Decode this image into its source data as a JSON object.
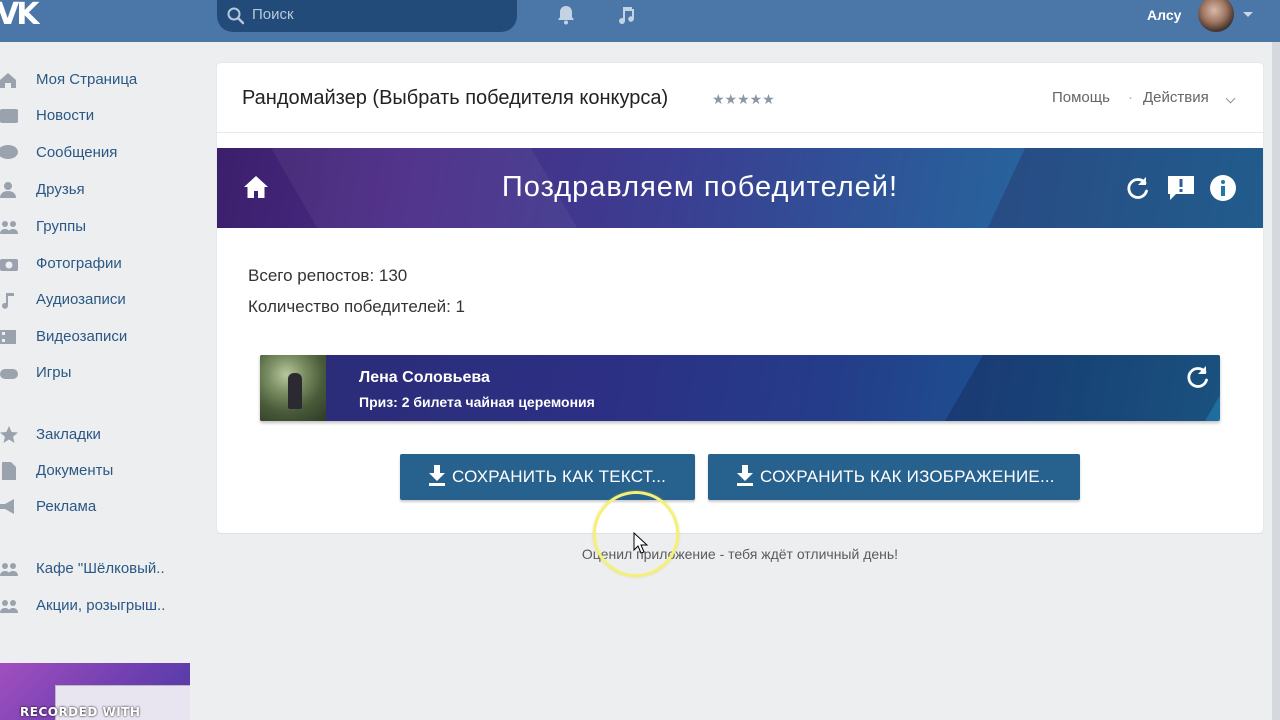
{
  "topbar": {
    "logo": "VK",
    "search_placeholder": "Поиск",
    "username": "Алсу"
  },
  "sidebar": {
    "items": [
      {
        "label": "Моя Страница",
        "icon": "home-icon"
      },
      {
        "label": "Новости",
        "icon": "news-icon"
      },
      {
        "label": "Сообщения",
        "icon": "messages-icon"
      },
      {
        "label": "Друзья",
        "icon": "friends-icon"
      },
      {
        "label": "Группы",
        "icon": "groups-icon"
      },
      {
        "label": "Фотографии",
        "icon": "camera-icon"
      },
      {
        "label": "Аудиозаписи",
        "icon": "music-icon"
      },
      {
        "label": "Видеозаписи",
        "icon": "video-icon"
      },
      {
        "label": "Игры",
        "icon": "gamepad-icon"
      },
      {
        "label": "Закладки",
        "icon": "star-icon"
      },
      {
        "label": "Документы",
        "icon": "document-icon"
      },
      {
        "label": "Реклама",
        "icon": "megaphone-icon"
      },
      {
        "label": "Кафе \"Шёлковый..",
        "icon": "group-icon"
      },
      {
        "label": "Акции, розыгрыш..",
        "icon": "group-icon"
      }
    ],
    "promo_text": "RECORDED WITH"
  },
  "app": {
    "title": "Рандомайзер (Выбрать победителя конкурса)",
    "stars": "★★★★★",
    "help_label": "Помощь",
    "separator": "·",
    "actions_label": "Действия",
    "banner_title": "Поздравляем победителей!",
    "stats": {
      "reposts": "Всего репостов: 130",
      "winners_count": "Количество победителей: 1"
    },
    "winner": {
      "name": "Лена Соловьева",
      "prize": "Приз: 2 билета чайная церемония"
    },
    "buttons": {
      "save_text": "СОХРАНИТЬ КАК ТЕКСТ...",
      "save_image": "СОХРАНИТЬ КАК ИЗОБРАЖЕНИЕ..."
    },
    "rate_note": "Оценил приложение - тебя ждёт отличный день!"
  },
  "colors": {
    "topbar": "#4a76a8",
    "link": "#2a5885",
    "button": "#27628e",
    "banner_start": "#3b1f6b",
    "banner_end": "#1f78a8"
  }
}
